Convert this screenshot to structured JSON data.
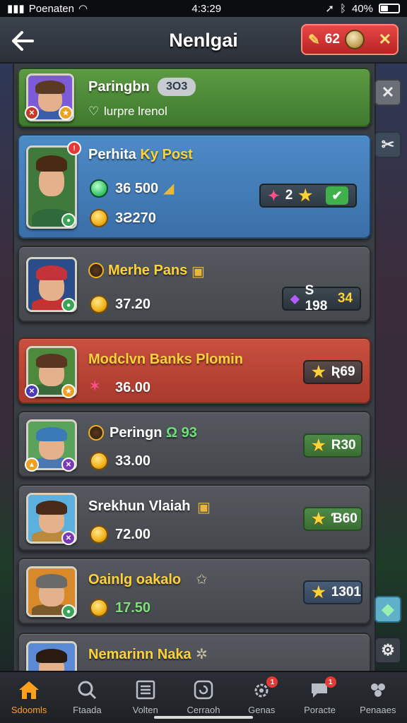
{
  "status_bar": {
    "carrier": "Poenaten",
    "time": "4:3:29",
    "battery": "40%",
    "battery_fraction": 0.4
  },
  "header": {
    "title": "Nenlgai",
    "badge_count": "62"
  },
  "list": [
    {
      "name": "Paringbn",
      "tag": "3O3",
      "subtitle": "lurpre lrenol",
      "style": "green",
      "colors": {
        "bg": "#7d5bd6",
        "hair": "#5a3a24",
        "body": "#3a5fa8"
      }
    },
    {
      "name": "Perhita",
      "name_accent": "Ky Post",
      "value1": "36 500",
      "value2": "3Ƨ270",
      "reward_count": "2",
      "style": "blue",
      "colors": {
        "bg": "#3f7a3c",
        "hair": "#4a2a14",
        "body": "#2f6a3a"
      }
    },
    {
      "name": "Merhe Pans",
      "value": "37.20",
      "pill": "S 198",
      "pill_extra": "34",
      "style": "gray",
      "colors": {
        "bg": "#2a4d8a",
        "hair": "#c4323a",
        "body": "#c63232"
      }
    },
    {
      "name": "Modclvn Banks Plomin",
      "value": "36.00",
      "pill": "Ʀ69",
      "style": "red",
      "colors": {
        "bg": "#4e8a3e",
        "hair": "#5a3520",
        "body": "#3a6a3a"
      }
    },
    {
      "name": "Peringn",
      "name_extra": "Ω 93",
      "value": "33.00",
      "pill": "R30",
      "style": "gray",
      "colors": {
        "bg": "#5aa35a",
        "hair": "#3a7ab8",
        "body": "#4a78b2"
      }
    },
    {
      "name": "Srekhun Vlaiah",
      "value": "72.00",
      "pill": "Ɓ60",
      "style": "gray",
      "colors": {
        "bg": "#5bb0e0",
        "hair": "#4a2a18",
        "body": "#b88a3a"
      }
    },
    {
      "name": "Oainlg oakalo",
      "value": "17.50",
      "pill": "1301",
      "style": "gray",
      "colors": {
        "bg": "#d88a2a",
        "hair": "#6a6a6a",
        "body": "#7a5a2a"
      }
    },
    {
      "name": "Nemarinn Naka",
      "style": "gray",
      "colors": {
        "bg": "#5a8ad6",
        "hair": "#2a1a10",
        "body": "#3a4a8a"
      }
    }
  ],
  "nav": [
    {
      "label": "Sdoomls",
      "icon": "home-icon",
      "active": true
    },
    {
      "label": "Ftaada",
      "icon": "search-icon"
    },
    {
      "label": "Volten",
      "icon": "list-icon"
    },
    {
      "label": "Cerraoh",
      "icon": "refresh-icon"
    },
    {
      "label": "Genas",
      "icon": "gear-icon",
      "badge": "1"
    },
    {
      "label": "Poracte",
      "icon": "chat-icon",
      "badge": "1"
    },
    {
      "label": "Penaaes",
      "icon": "group-icon"
    }
  ]
}
